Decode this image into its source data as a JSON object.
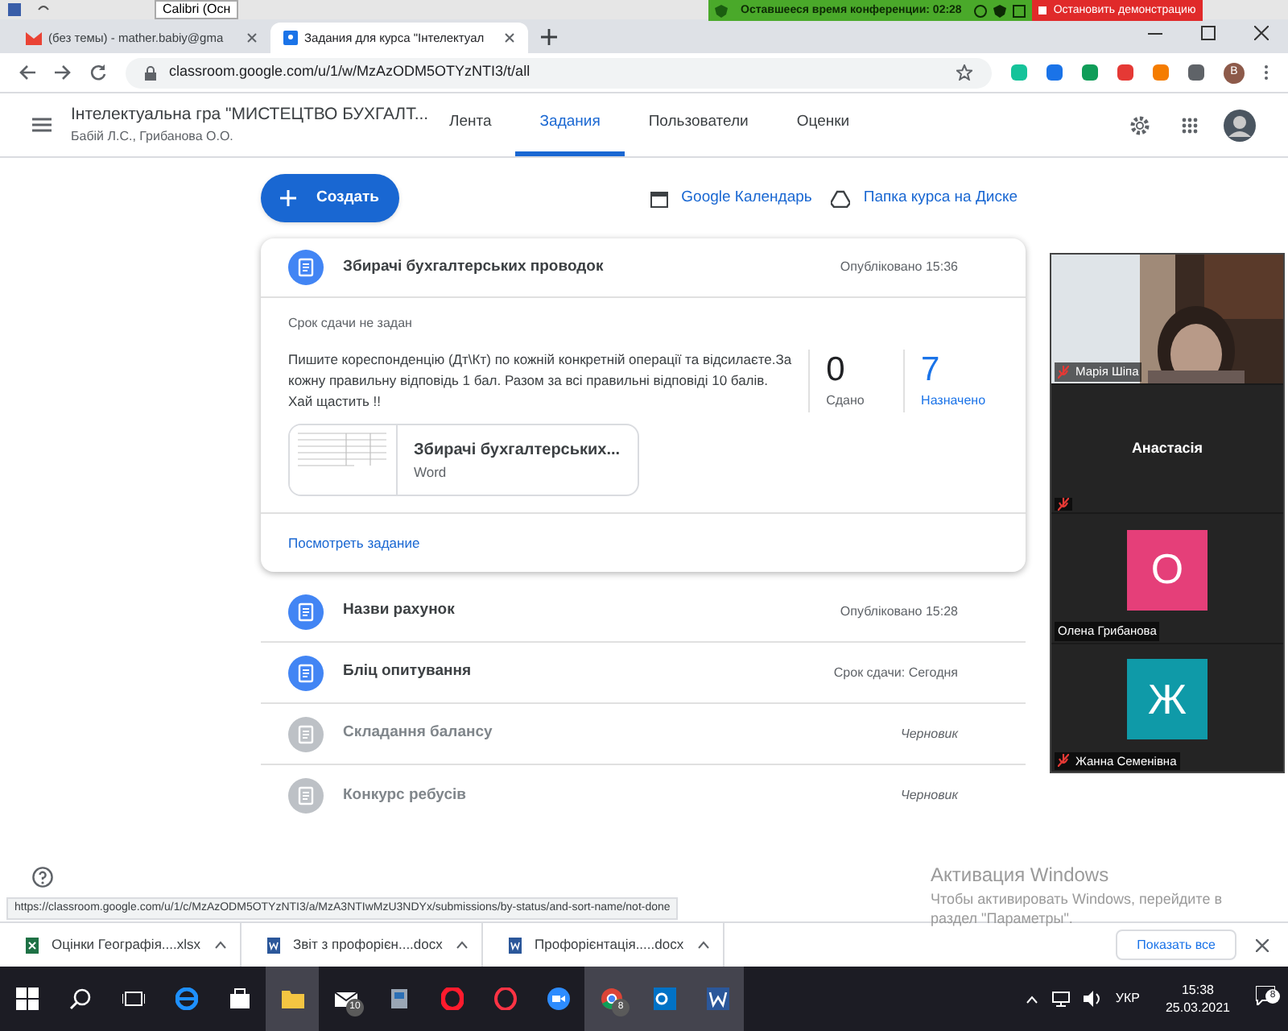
{
  "word_toolbar": {
    "font_box": "Calibri (Осн"
  },
  "zoom_bar": {
    "timer": "Оставшееся время конференции: 02:28",
    "stop_button": "Остановить демонстрацию"
  },
  "browser": {
    "tabs": [
      {
        "title": "(без темы) - mather.babiy@gma",
        "selected": false
      },
      {
        "title": "Задания для курса \"Інтелектуал",
        "selected": true
      }
    ],
    "url": "classroom.google.com/u/1/w/MzAzODM5OTYzNTI3/t/all",
    "profile_initial": "B"
  },
  "course": {
    "title": "Інтелектуальна гра \"МИСТЕЦТВО БУХГАЛТ...",
    "teachers": "Бабій Л.С., Грибанова О.О.",
    "nav": [
      {
        "label": "Лента",
        "selected": false
      },
      {
        "label": "Задания",
        "selected": true
      },
      {
        "label": "Пользователи",
        "selected": false
      },
      {
        "label": "Оценки",
        "selected": false
      }
    ]
  },
  "create_button": "Создать",
  "links": [
    {
      "label": "Google Календарь"
    },
    {
      "label": "Папка курса на Диске"
    }
  ],
  "expanded_assignment": {
    "title": "Збирачі бухгалтерських проводок",
    "status": "Опубліковано 15:36",
    "due": "Срок сдачи не задан",
    "description": "Пишите кореспонденцію (Дт\\Кт) по кожній конкретній операції та відсилаєте.За кожну правильну відповідь 1 бал. Разом за всі правильні відповіді 10 балів. Хай щастить !!",
    "stats": [
      {
        "count": "0",
        "label": "Сдано",
        "highlight": false
      },
      {
        "count": "7",
        "label": "Назначено",
        "highlight": true
      }
    ],
    "attachment": {
      "title": "Збирачі бухгалтерських...",
      "type": "Word"
    },
    "view_link": "Посмотреть задание"
  },
  "assignments": [
    {
      "title": "Назви рахунок",
      "status": "Опубліковано 15:28",
      "draft": false
    },
    {
      "title": "Бліц опитування",
      "status": "Срок сдачи: Сегодня",
      "draft": false
    },
    {
      "title": "Складання балансу",
      "status": "Черновик",
      "draft": true
    },
    {
      "title": "Конкурс ребусів",
      "status": "Черновик",
      "draft": true
    }
  ],
  "participants": [
    {
      "kind": "video",
      "name": "Марія Шіпа",
      "muted": true
    },
    {
      "kind": "name",
      "name": "Анастасія",
      "muted": true
    },
    {
      "kind": "avatar",
      "name": "Олена Грибанова",
      "letter": "О",
      "color": "#e53f79",
      "muted": false
    },
    {
      "kind": "avatar",
      "name": "Жанна Семенівна",
      "letter": "Ж",
      "color": "#0f9aa8",
      "muted": true
    }
  ],
  "status_url": "https://classroom.google.com/u/1/c/MzAzODM5OTYzNTI3/a/MzA3NTIwMzU3NDYx/submissions/by-status/and-sort-name/not-done",
  "activation": {
    "title": "Активация Windows",
    "lines": [
      "Чтобы активировать Windows, перейдите в",
      "раздел \"Параметры\"."
    ]
  },
  "downloads": [
    {
      "name": "Оцінки Географія....xlsx"
    },
    {
      "name": "Звіт з профорієн....docx"
    },
    {
      "name": "Профорієнтація.....docx"
    }
  ],
  "show_all": "Показать все",
  "taskbar": {
    "mail_badge": "10",
    "chrome_badge": "8",
    "language": "УКР",
    "time": "15:38",
    "date": "25.03.2021",
    "notifications": "8"
  }
}
